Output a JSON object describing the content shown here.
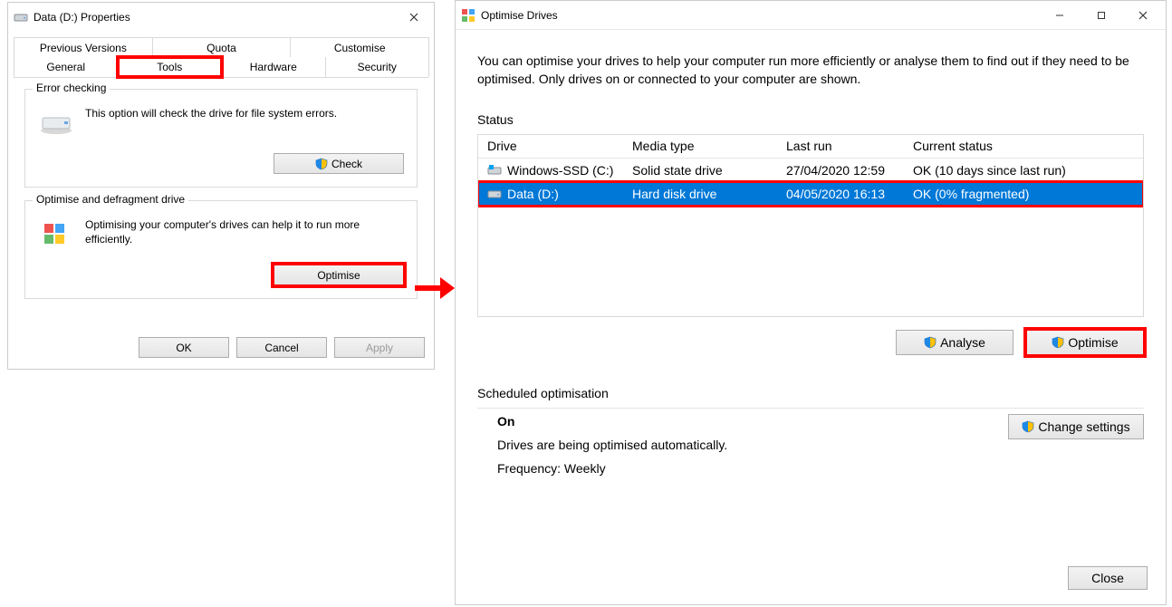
{
  "properties": {
    "title": "Data (D:) Properties",
    "tabs_row1": [
      "Previous Versions",
      "Quota",
      "Customise"
    ],
    "tabs_row2": [
      "General",
      "Tools",
      "Hardware",
      "Security"
    ],
    "active_tab": "Tools",
    "error_check": {
      "legend": "Error checking",
      "text": "This option will check the drive for file system errors.",
      "button": "Check"
    },
    "optimise": {
      "legend": "Optimise and defragment drive",
      "text": "Optimising your computer's drives can help it to run more efficiently.",
      "button": "Optimise"
    },
    "footer": {
      "ok": "OK",
      "cancel": "Cancel",
      "apply": "Apply"
    }
  },
  "optimise_drives": {
    "title": "Optimise Drives",
    "description": "You can optimise your drives to help your computer run more efficiently or analyse them to find out if they need to be optimised. Only drives on or connected to your computer are shown.",
    "status_label": "Status",
    "columns": {
      "drive": "Drive",
      "media": "Media type",
      "last_run": "Last run",
      "status": "Current status"
    },
    "rows": [
      {
        "drive": "Windows-SSD (C:)",
        "media": "Solid state drive",
        "last_run": "27/04/2020 12:59",
        "status": "OK (10 days since last run)",
        "selected": false
      },
      {
        "drive": "Data (D:)",
        "media": "Hard disk drive",
        "last_run": "04/05/2020 16:13",
        "status": "OK (0% fragmented)",
        "selected": true
      }
    ],
    "analyse_button": "Analyse",
    "optimise_button": "Optimise",
    "scheduled": {
      "label": "Scheduled optimisation",
      "on": "On",
      "line1": "Drives are being optimised automatically.",
      "line2": "Frequency: Weekly",
      "change_button": "Change settings"
    },
    "close": "Close"
  }
}
